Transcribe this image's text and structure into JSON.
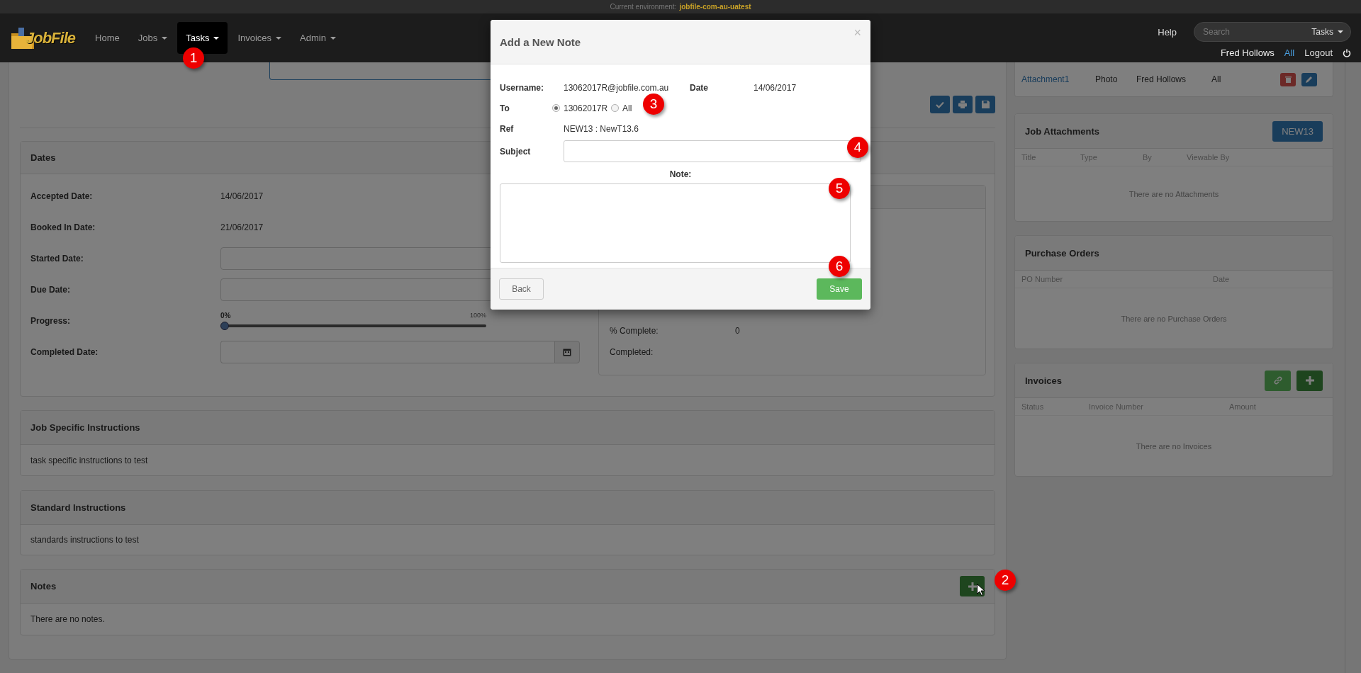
{
  "environment_bar": {
    "label": "Current environment:",
    "value": "jobfile-com-au-uatest"
  },
  "navbar": {
    "logo": "JobFile",
    "items": [
      {
        "label": "Home",
        "dropdown": false,
        "selected": false
      },
      {
        "label": "Jobs",
        "dropdown": true,
        "selected": false
      },
      {
        "label": "Tasks",
        "dropdown": true,
        "selected": true
      },
      {
        "label": "Invoices",
        "dropdown": true,
        "selected": false
      },
      {
        "label": "Admin",
        "dropdown": true,
        "selected": false
      }
    ],
    "help": "Help",
    "search": {
      "placeholder": "Search",
      "scope": "Tasks"
    },
    "user": "Fred Hollows",
    "scope_link": "All",
    "logout": "Logout"
  },
  "dates_panel": {
    "title": "Dates",
    "rows": [
      {
        "kind": "text",
        "label": "Accepted Date:",
        "value": "14/06/2017"
      },
      {
        "kind": "text",
        "label": "Booked In Date:",
        "value": "21/06/2017"
      },
      {
        "kind": "input",
        "label": "Started Date:"
      },
      {
        "kind": "input",
        "label": "Due Date:"
      },
      {
        "kind": "slider",
        "label": "Progress:",
        "level": 0,
        "min_label": "0%",
        "max_label": "100%"
      },
      {
        "kind": "date",
        "label": "Completed Date:"
      }
    ],
    "summary": [
      {
        "label": "% Complete:",
        "value": "0"
      },
      {
        "label": "Completed:"
      }
    ]
  },
  "instructions": [
    {
      "title": "Job Specific Instructions",
      "body": "task specific instructions to test"
    },
    {
      "title": "Standard Instructions",
      "body": "standards instructions to test"
    }
  ],
  "notes": {
    "title": "Notes",
    "empty": "There are no notes."
  },
  "task_attachments": {
    "rows": [
      {
        "title": "Attachment1",
        "type": "Photo",
        "by": "Fred Hollows",
        "viewable_by": "All"
      }
    ]
  },
  "job_attachments": {
    "title": "Job Attachments",
    "button": "NEW13",
    "columns": [
      "Title",
      "Type",
      "By",
      "Viewable By"
    ],
    "empty": "There are no Attachments"
  },
  "purchase_orders": {
    "title": "Purchase Orders",
    "columns": [
      "PO Number",
      "Date"
    ],
    "empty": "There are no Purchase Orders"
  },
  "invoices": {
    "title": "Invoices",
    "columns": [
      "Status",
      "Invoice Number",
      "Amount"
    ],
    "empty": "There are no Invoices"
  },
  "modal": {
    "title": "Add a New Note",
    "close": "×",
    "username_label": "Username:",
    "username": "13062017R@jobfile.com.au",
    "date_label": "Date",
    "date": "14/06/2017",
    "to_label": "To",
    "recipients": [
      {
        "label": "13062017R",
        "selected": true
      },
      {
        "label": "All",
        "selected": false
      }
    ],
    "ref_label": "Ref",
    "ref": "NEW13 : NewT13.6",
    "subject_label": "Subject",
    "note_label": "Note:",
    "back": "Back",
    "save": "Save"
  },
  "callouts": [
    "1",
    "2",
    "3",
    "4",
    "5",
    "6"
  ]
}
